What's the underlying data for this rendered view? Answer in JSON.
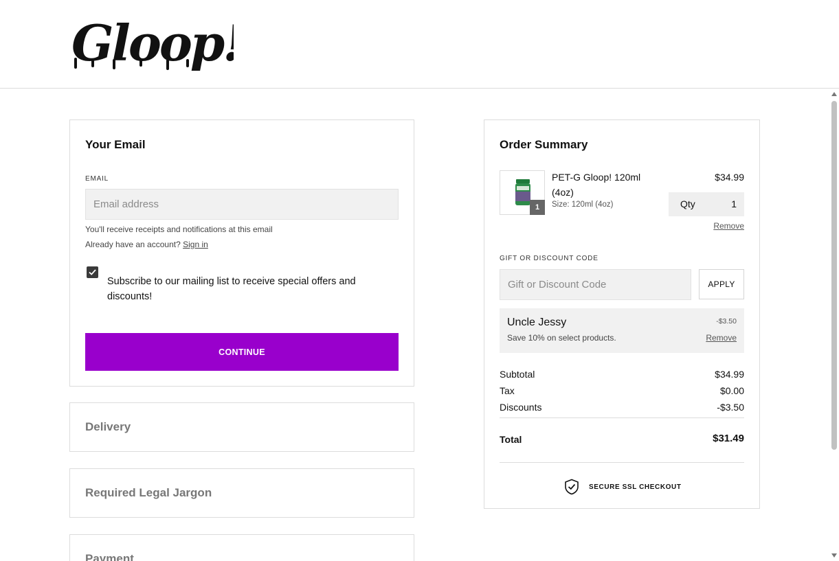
{
  "brand": {
    "logo_text": "Gloop!"
  },
  "email_section": {
    "title": "Your Email",
    "field_label": "EMAIL",
    "placeholder": "Email address",
    "receipts_note": "You'll receive receipts and notifications at this email",
    "account_prompt": "Already have an account?",
    "sign_in_link": "Sign in",
    "subscribe_checked": true,
    "subscribe_label": "Subscribe to our mailing list to receive special offers and discounts!",
    "continue_label": "CONTINUE"
  },
  "sections": [
    {
      "title": "Delivery"
    },
    {
      "title": "Required Legal Jargon"
    },
    {
      "title": "Payment"
    }
  ],
  "order_summary": {
    "title": "Order Summary",
    "item": {
      "name": "PET-G Gloop! 120ml (4oz)",
      "size": "Size: 120ml (4oz)",
      "price": "$34.99",
      "qty_label": "Qty",
      "qty_value": "1",
      "badge": "1",
      "remove_label": "Remove"
    },
    "gift": {
      "label": "GIFT OR DISCOUNT CODE",
      "placeholder": "Gift or Discount Code",
      "apply_label": "APPLY"
    },
    "discount": {
      "name": "Uncle Jessy",
      "amount": "-$3.50",
      "description": "Save 10% on select products.",
      "remove_label": "Remove"
    },
    "totals": {
      "subtotal_label": "Subtotal",
      "subtotal": "$34.99",
      "tax_label": "Tax",
      "tax": "$0.00",
      "discounts_label": "Discounts",
      "discounts": "-$3.50",
      "total_label": "Total",
      "total": "$31.49"
    },
    "secure_label": "SECURE SSL CHECKOUT"
  },
  "colors": {
    "accent": "#9900cc",
    "input_bg": "#f1f1f1",
    "border": "#dcdcdc"
  },
  "icons": {
    "checkbox": "checkmark-icon",
    "secure": "shield-check-icon"
  }
}
